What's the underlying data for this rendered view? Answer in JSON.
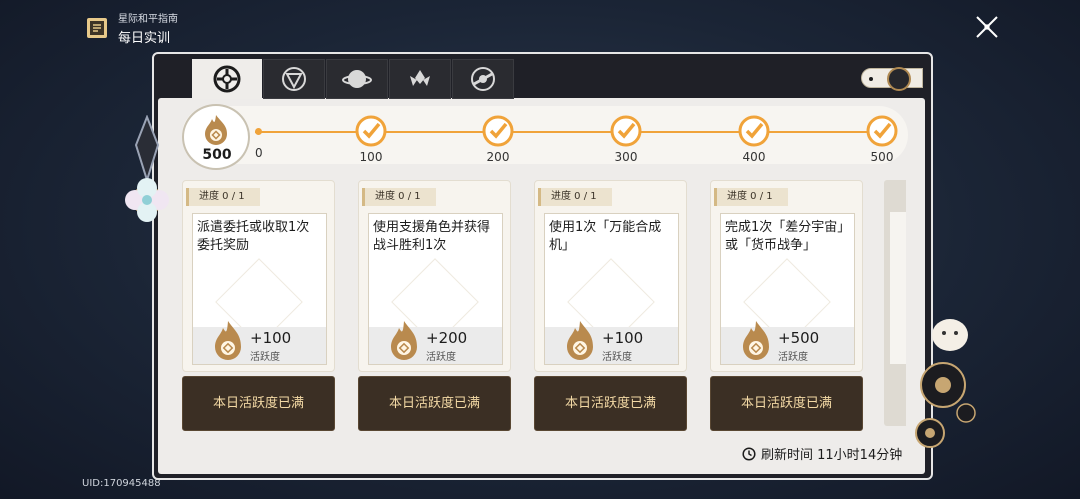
{
  "header": {
    "subtitle": "星际和平指南",
    "title": "每日实训",
    "icon": "guide-book-icon"
  },
  "close_icon": "close-icon",
  "uid": "UID:170945488",
  "tabs": [
    {
      "icon": "daily-training-icon",
      "active": true
    },
    {
      "icon": "shield-icon",
      "active": false
    },
    {
      "icon": "planet-icon",
      "active": false
    },
    {
      "icon": "lotus-icon",
      "active": false
    },
    {
      "icon": "orbit-icon",
      "active": false
    }
  ],
  "progress": {
    "current": "500",
    "start": "0",
    "milestones": [
      "100",
      "200",
      "300",
      "400",
      "500"
    ],
    "fill_fraction": 1.0,
    "accent": "#f0a33a"
  },
  "tasks": [
    {
      "progress_label": "进度 0 / 1",
      "desc": "派遣委托或收取1次委托奖励",
      "reward": "+100",
      "reward_label": "活跃度",
      "button": "本日活跃度已满"
    },
    {
      "progress_label": "进度 0 / 1",
      "desc": "使用支援角色并获得战斗胜利1次",
      "reward": "+200",
      "reward_label": "活跃度",
      "button": "本日活跃度已满"
    },
    {
      "progress_label": "进度 0 / 1",
      "desc": "使用1次「万能合成机」",
      "reward": "+100",
      "reward_label": "活跃度",
      "button": "本日活跃度已满"
    },
    {
      "progress_label": "进度 0 / 1",
      "desc": "完成1次「差分宇宙」或「货币战争」",
      "reward": "+500",
      "reward_label": "活跃度",
      "button": "本日活跃度已满"
    }
  ],
  "refresh": {
    "label": "刷新时间 11小时14分钟",
    "icon": "clock-icon"
  }
}
